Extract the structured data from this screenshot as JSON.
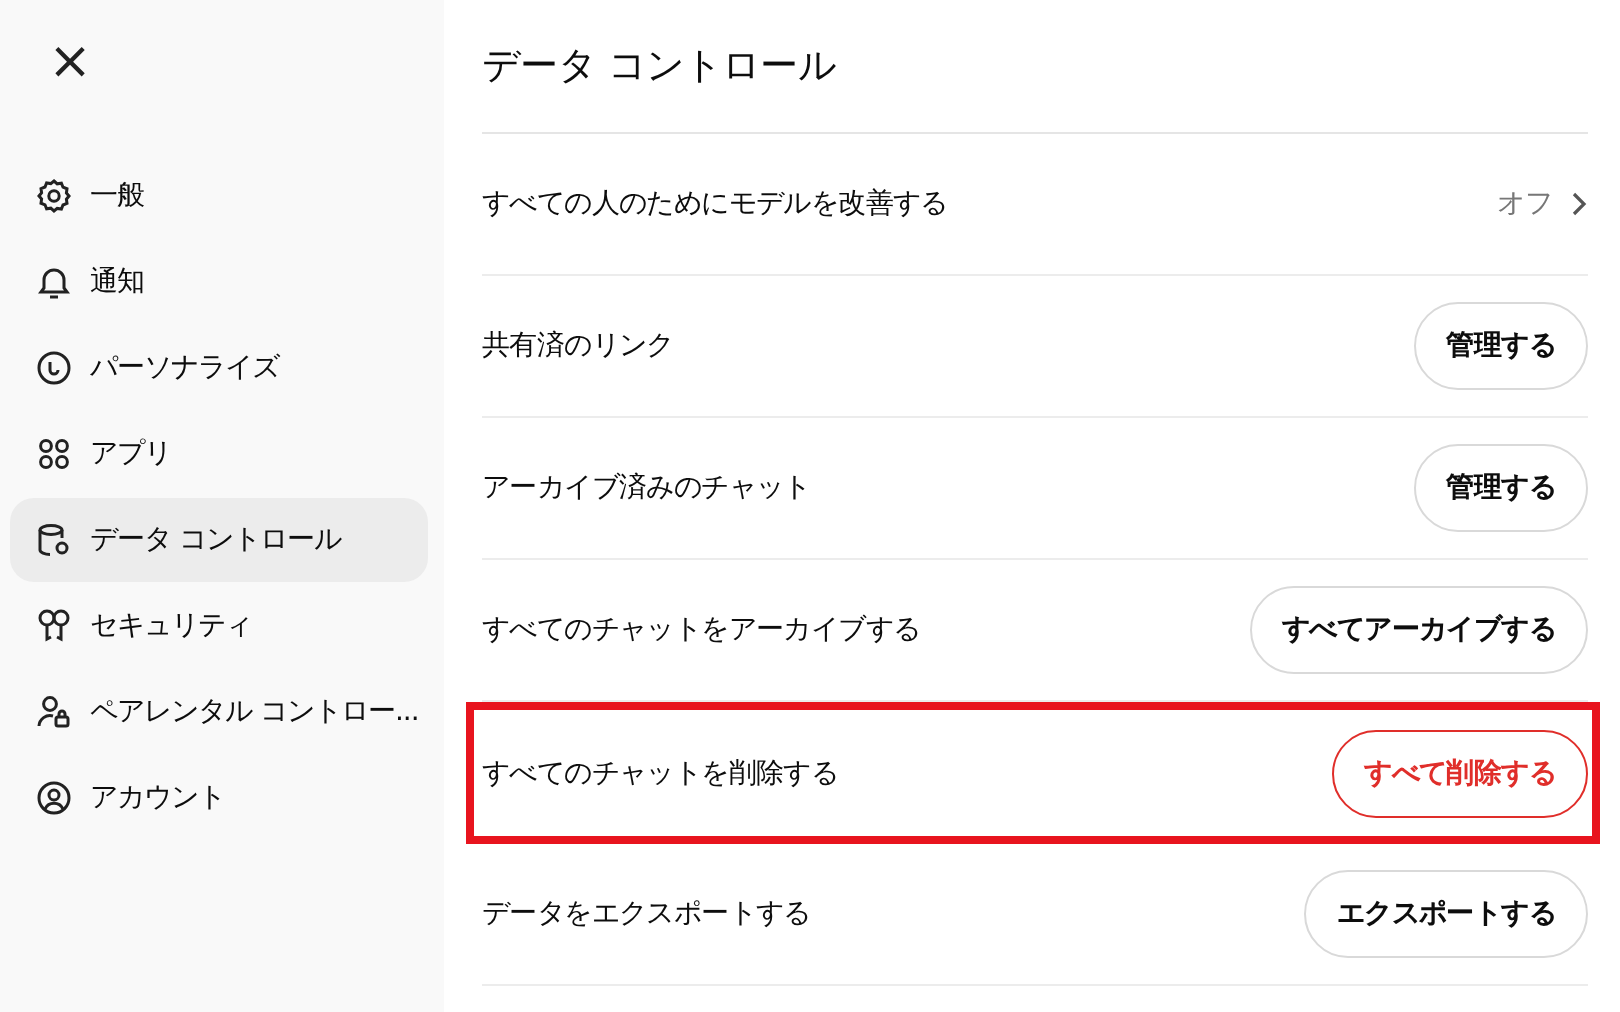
{
  "close_button": "×",
  "sidebar": {
    "items": [
      {
        "label": "一般",
        "selected": false
      },
      {
        "label": "通知",
        "selected": false
      },
      {
        "label": "パーソナライズ",
        "selected": false
      },
      {
        "label": "アプリ",
        "selected": false
      },
      {
        "label": "データ コントロール",
        "selected": true
      },
      {
        "label": "セキュリティ",
        "selected": false
      },
      {
        "label": "ペアレンタル コントロー...",
        "selected": false
      },
      {
        "label": "アカウント",
        "selected": false
      }
    ]
  },
  "panel": {
    "title": "データ コントロール",
    "rows": [
      {
        "kind": "link",
        "label": "すべての人のためにモデルを改善する",
        "value": "オフ",
        "highlighted": false
      },
      {
        "kind": "button",
        "label": "共有済のリンク",
        "button": "管理する",
        "danger": false,
        "highlighted": false
      },
      {
        "kind": "button",
        "label": "アーカイブ済みのチャット",
        "button": "管理する",
        "danger": false,
        "highlighted": false
      },
      {
        "kind": "button",
        "label": "すべてのチャットをアーカイブする",
        "button": "すべてアーカイブする",
        "danger": false,
        "highlighted": false
      },
      {
        "kind": "button",
        "label": "すべてのチャットを削除する",
        "button": "すべて削除する",
        "danger": true,
        "highlighted": true
      },
      {
        "kind": "button",
        "label": "データをエクスポートする",
        "button": "エクスポートする",
        "danger": false,
        "highlighted": false
      }
    ]
  }
}
